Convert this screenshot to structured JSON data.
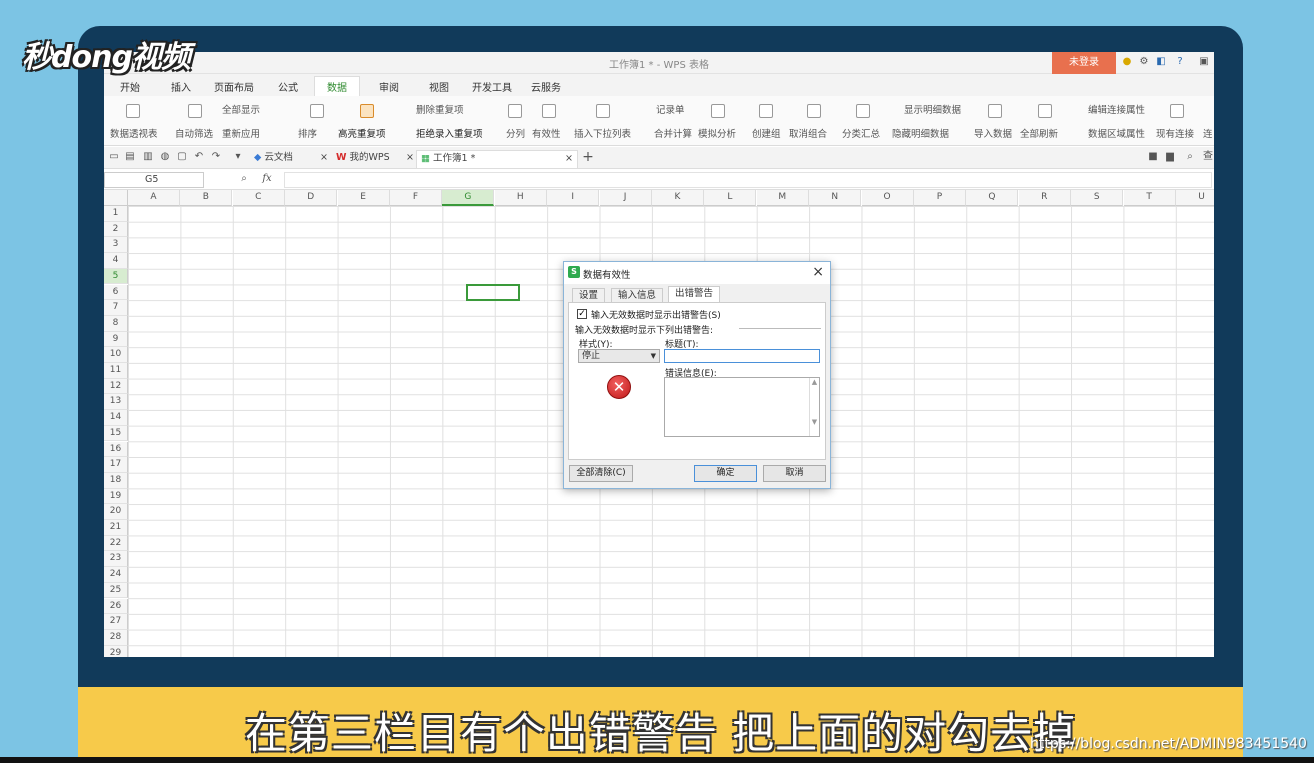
{
  "logo": "秒dong视频",
  "window": {
    "title": "工作簿1 * - WPS 表格",
    "login_button": "未登录"
  },
  "menu": [
    "开始",
    "插入",
    "页面布局",
    "公式",
    "数据",
    "审阅",
    "视图",
    "开发工具",
    "云服务"
  ],
  "active_menu": "数据",
  "ribbon": {
    "top_row": [
      "全部显示",
      "删除重复项",
      "记录单",
      "显示明细数据",
      "编辑连接属性"
    ],
    "bottom_row": [
      "数据透视表",
      "自动筛选",
      "重新应用",
      "排序",
      "高亮重复项",
      "拒绝录入重复项",
      "分列",
      "有效性",
      "插入下拉列表",
      "合并计算",
      "模拟分析",
      "创建组",
      "取消组合",
      "分类汇总",
      "隐藏明细数据",
      "导入数据",
      "全部刷新",
      "数据区域属性",
      "现有连接",
      "连"
    ]
  },
  "tabs": {
    "items": [
      "云文档",
      "我的WPS",
      "工作簿1 *"
    ],
    "active": "工作簿1 *",
    "search_hint": "查"
  },
  "formula": {
    "name_box": "G5",
    "fx": "fx"
  },
  "grid": {
    "columns": [
      "A",
      "B",
      "C",
      "D",
      "E",
      "F",
      "G",
      "H",
      "I",
      "J",
      "K",
      "L",
      "M",
      "N",
      "O",
      "P",
      "Q",
      "R",
      "S",
      "T",
      "U"
    ],
    "rows": [
      "1",
      "2",
      "3",
      "4",
      "5",
      "6",
      "7",
      "8",
      "9",
      "10",
      "11",
      "12",
      "13",
      "14",
      "15",
      "16",
      "17",
      "18",
      "19",
      "20",
      "21",
      "22",
      "23",
      "24",
      "25",
      "26",
      "27",
      "28",
      "29"
    ],
    "selected_cell": "G5"
  },
  "dialog": {
    "title": "数据有效性",
    "tabs": [
      "设置",
      "输入信息",
      "出错警告"
    ],
    "active_tab": "出错警告",
    "checkbox_label": "输入无效数据时显示出错警告(S)",
    "checkbox_checked": true,
    "section_label": "输入无效数据时显示下列出错警告:",
    "style_label": "样式(Y):",
    "style_value": "停止",
    "title_label": "标题(T):",
    "title_value": "",
    "message_label": "错误信息(E):",
    "message_value": "",
    "clear_all_button": "全部清除(C)",
    "ok_button": "确定",
    "cancel_button": "取消"
  },
  "subtitle": "在第三栏目有个出错警告 把上面的对勾去掉",
  "watermark_url": "https://blog.csdn.net/ADMIN983451540"
}
